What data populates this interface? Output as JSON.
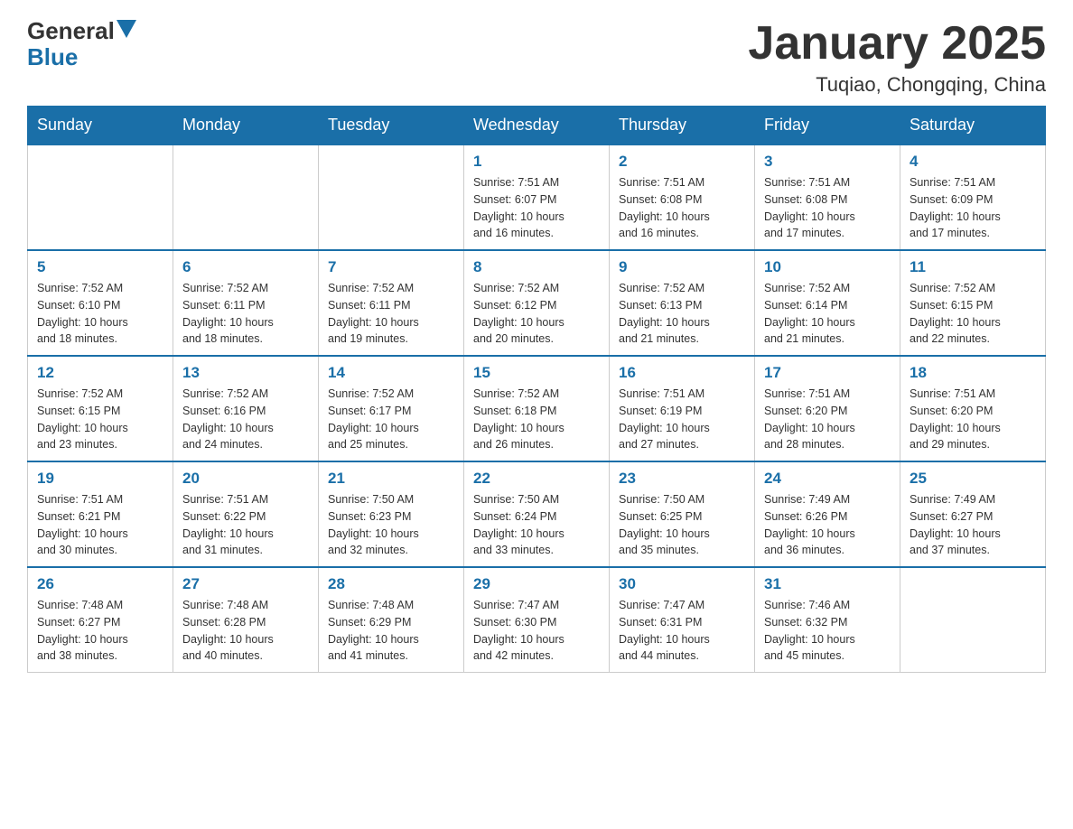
{
  "header": {
    "logo_general": "General",
    "logo_blue": "Blue",
    "month_title": "January 2025",
    "location": "Tuqiao, Chongqing, China"
  },
  "days_of_week": [
    "Sunday",
    "Monday",
    "Tuesday",
    "Wednesday",
    "Thursday",
    "Friday",
    "Saturday"
  ],
  "weeks": [
    [
      {
        "day": "",
        "info": ""
      },
      {
        "day": "",
        "info": ""
      },
      {
        "day": "",
        "info": ""
      },
      {
        "day": "1",
        "info": "Sunrise: 7:51 AM\nSunset: 6:07 PM\nDaylight: 10 hours\nand 16 minutes."
      },
      {
        "day": "2",
        "info": "Sunrise: 7:51 AM\nSunset: 6:08 PM\nDaylight: 10 hours\nand 16 minutes."
      },
      {
        "day": "3",
        "info": "Sunrise: 7:51 AM\nSunset: 6:08 PM\nDaylight: 10 hours\nand 17 minutes."
      },
      {
        "day": "4",
        "info": "Sunrise: 7:51 AM\nSunset: 6:09 PM\nDaylight: 10 hours\nand 17 minutes."
      }
    ],
    [
      {
        "day": "5",
        "info": "Sunrise: 7:52 AM\nSunset: 6:10 PM\nDaylight: 10 hours\nand 18 minutes."
      },
      {
        "day": "6",
        "info": "Sunrise: 7:52 AM\nSunset: 6:11 PM\nDaylight: 10 hours\nand 18 minutes."
      },
      {
        "day": "7",
        "info": "Sunrise: 7:52 AM\nSunset: 6:11 PM\nDaylight: 10 hours\nand 19 minutes."
      },
      {
        "day": "8",
        "info": "Sunrise: 7:52 AM\nSunset: 6:12 PM\nDaylight: 10 hours\nand 20 minutes."
      },
      {
        "day": "9",
        "info": "Sunrise: 7:52 AM\nSunset: 6:13 PM\nDaylight: 10 hours\nand 21 minutes."
      },
      {
        "day": "10",
        "info": "Sunrise: 7:52 AM\nSunset: 6:14 PM\nDaylight: 10 hours\nand 21 minutes."
      },
      {
        "day": "11",
        "info": "Sunrise: 7:52 AM\nSunset: 6:15 PM\nDaylight: 10 hours\nand 22 minutes."
      }
    ],
    [
      {
        "day": "12",
        "info": "Sunrise: 7:52 AM\nSunset: 6:15 PM\nDaylight: 10 hours\nand 23 minutes."
      },
      {
        "day": "13",
        "info": "Sunrise: 7:52 AM\nSunset: 6:16 PM\nDaylight: 10 hours\nand 24 minutes."
      },
      {
        "day": "14",
        "info": "Sunrise: 7:52 AM\nSunset: 6:17 PM\nDaylight: 10 hours\nand 25 minutes."
      },
      {
        "day": "15",
        "info": "Sunrise: 7:52 AM\nSunset: 6:18 PM\nDaylight: 10 hours\nand 26 minutes."
      },
      {
        "day": "16",
        "info": "Sunrise: 7:51 AM\nSunset: 6:19 PM\nDaylight: 10 hours\nand 27 minutes."
      },
      {
        "day": "17",
        "info": "Sunrise: 7:51 AM\nSunset: 6:20 PM\nDaylight: 10 hours\nand 28 minutes."
      },
      {
        "day": "18",
        "info": "Sunrise: 7:51 AM\nSunset: 6:20 PM\nDaylight: 10 hours\nand 29 minutes."
      }
    ],
    [
      {
        "day": "19",
        "info": "Sunrise: 7:51 AM\nSunset: 6:21 PM\nDaylight: 10 hours\nand 30 minutes."
      },
      {
        "day": "20",
        "info": "Sunrise: 7:51 AM\nSunset: 6:22 PM\nDaylight: 10 hours\nand 31 minutes."
      },
      {
        "day": "21",
        "info": "Sunrise: 7:50 AM\nSunset: 6:23 PM\nDaylight: 10 hours\nand 32 minutes."
      },
      {
        "day": "22",
        "info": "Sunrise: 7:50 AM\nSunset: 6:24 PM\nDaylight: 10 hours\nand 33 minutes."
      },
      {
        "day": "23",
        "info": "Sunrise: 7:50 AM\nSunset: 6:25 PM\nDaylight: 10 hours\nand 35 minutes."
      },
      {
        "day": "24",
        "info": "Sunrise: 7:49 AM\nSunset: 6:26 PM\nDaylight: 10 hours\nand 36 minutes."
      },
      {
        "day": "25",
        "info": "Sunrise: 7:49 AM\nSunset: 6:27 PM\nDaylight: 10 hours\nand 37 minutes."
      }
    ],
    [
      {
        "day": "26",
        "info": "Sunrise: 7:48 AM\nSunset: 6:27 PM\nDaylight: 10 hours\nand 38 minutes."
      },
      {
        "day": "27",
        "info": "Sunrise: 7:48 AM\nSunset: 6:28 PM\nDaylight: 10 hours\nand 40 minutes."
      },
      {
        "day": "28",
        "info": "Sunrise: 7:48 AM\nSunset: 6:29 PM\nDaylight: 10 hours\nand 41 minutes."
      },
      {
        "day": "29",
        "info": "Sunrise: 7:47 AM\nSunset: 6:30 PM\nDaylight: 10 hours\nand 42 minutes."
      },
      {
        "day": "30",
        "info": "Sunrise: 7:47 AM\nSunset: 6:31 PM\nDaylight: 10 hours\nand 44 minutes."
      },
      {
        "day": "31",
        "info": "Sunrise: 7:46 AM\nSunset: 6:32 PM\nDaylight: 10 hours\nand 45 minutes."
      },
      {
        "day": "",
        "info": ""
      }
    ]
  ]
}
